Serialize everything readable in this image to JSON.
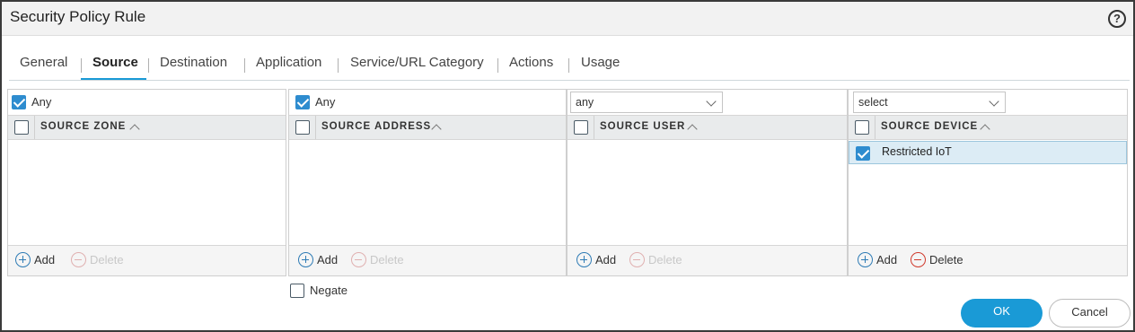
{
  "dialog": {
    "title": "Security Policy Rule",
    "help_icon": "?"
  },
  "tabs": [
    {
      "label": "General",
      "active": false
    },
    {
      "label": "Source",
      "active": true
    },
    {
      "label": "Destination",
      "active": false
    },
    {
      "label": "Application",
      "active": false
    },
    {
      "label": "Service/URL Category",
      "active": false
    },
    {
      "label": "Actions",
      "active": false
    },
    {
      "label": "Usage",
      "active": false
    }
  ],
  "panels": {
    "zone": {
      "any_label": "Any",
      "any_checked": true,
      "header": "SOURCE ZONE",
      "add_label": "Add",
      "delete_label": "Delete"
    },
    "address": {
      "any_label": "Any",
      "any_checked": true,
      "header": "SOURCE ADDRESS",
      "add_label": "Add",
      "delete_label": "Delete"
    },
    "user": {
      "select_value": "any",
      "header": "SOURCE USER",
      "add_label": "Add",
      "delete_label": "Delete"
    },
    "device": {
      "select_value": "select",
      "header": "SOURCE DEVICE",
      "rows": [
        {
          "label": "Restricted IoT",
          "checked": true
        }
      ],
      "add_label": "Add",
      "delete_label": "Delete"
    }
  },
  "negate_label": "Negate",
  "buttons": {
    "ok": "OK",
    "cancel": "Cancel"
  },
  "colors": {
    "accent": "#1a9ad6",
    "checkbox": "#2e8ccf",
    "delete_enabled": "#d0392b",
    "selected_row": "#dcecf5"
  }
}
